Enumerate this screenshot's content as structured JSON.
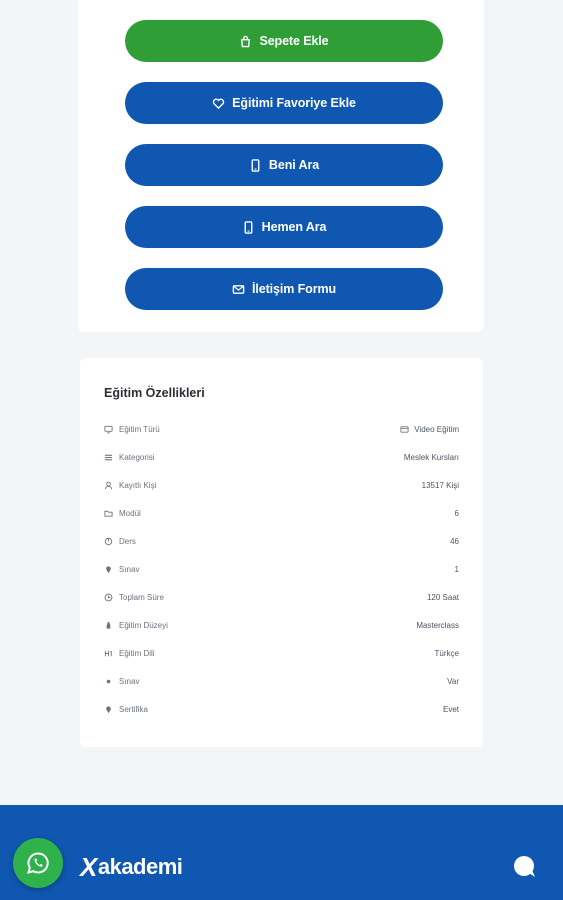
{
  "actions": {
    "add_to_cart": "Sepete Ekle",
    "add_favorite": "Eğitimi Favoriye Ekle",
    "call_me": "Beni Ara",
    "call_now": "Hemen Ara",
    "contact_form": "İletişim Formu"
  },
  "features": {
    "title": "Eğitim Özellikleri",
    "rows": [
      {
        "label": "Eğitim Türü",
        "value": "Video Eğitim",
        "icon": "monitor-icon"
      },
      {
        "label": "Kategorisi",
        "value": "Meslek Kursları",
        "icon": "list-icon"
      },
      {
        "label": "Kayıtlı Kişi",
        "value": "13517 Kişi",
        "icon": "user-icon"
      },
      {
        "label": "Modül",
        "value": "6",
        "icon": "folder-icon"
      },
      {
        "label": "Ders",
        "value": "46",
        "icon": "book-icon"
      },
      {
        "label": "Sınav",
        "value": "1",
        "icon": "pin-icon"
      },
      {
        "label": "Toplam Süre",
        "value": "120 Saat",
        "icon": "clock-icon"
      },
      {
        "label": "Eğitim Düzeyi",
        "value": "Masterclass",
        "icon": "level-icon"
      },
      {
        "label": "Eğitim Dili",
        "value": "Türkçe",
        "icon": "language-icon"
      },
      {
        "label": "Sınav",
        "value": "Var",
        "icon": "dot-icon"
      },
      {
        "label": "Sertifika",
        "value": "Evet",
        "icon": "pin-icon"
      }
    ]
  },
  "footer": {
    "logo_x": "X",
    "logo_text": "akademi"
  },
  "colors": {
    "green": "#2f9e36",
    "blue": "#0f57b0",
    "whatsapp": "#2fb24b"
  }
}
